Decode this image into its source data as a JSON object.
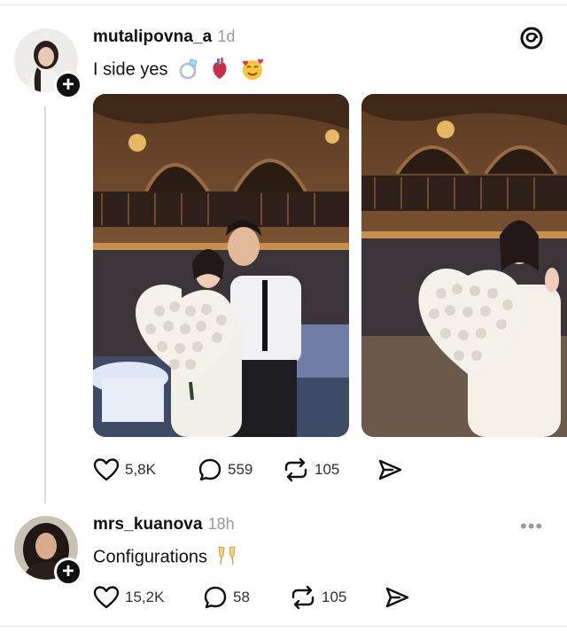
{
  "post1": {
    "username": "mutalipovna_a",
    "time": "1d",
    "text": "I side yes",
    "emojis": [
      "ring-emoji",
      "anatomical-heart-emoji",
      "smiling-face-with-hearts-emoji"
    ],
    "likes": "5,8K",
    "replies": "559",
    "reposts": "105"
  },
  "post2": {
    "username": "mrs_kuanova",
    "time": "18h",
    "text": "Configurations",
    "emojis": [
      "clinking-glasses-emoji"
    ],
    "likes": "15,2K",
    "replies": "58",
    "reposts": "105"
  },
  "icons": {
    "app_logo": "threads-logo-icon",
    "follow": "plus-icon",
    "like": "heart-icon",
    "reply": "comment-bubble-icon",
    "repost": "repost-icon",
    "share": "send-icon",
    "more": "more-dots-icon"
  },
  "colors": {
    "text": "#101010",
    "muted": "#9a9a9a",
    "thread_line": "#d9d9d9"
  }
}
